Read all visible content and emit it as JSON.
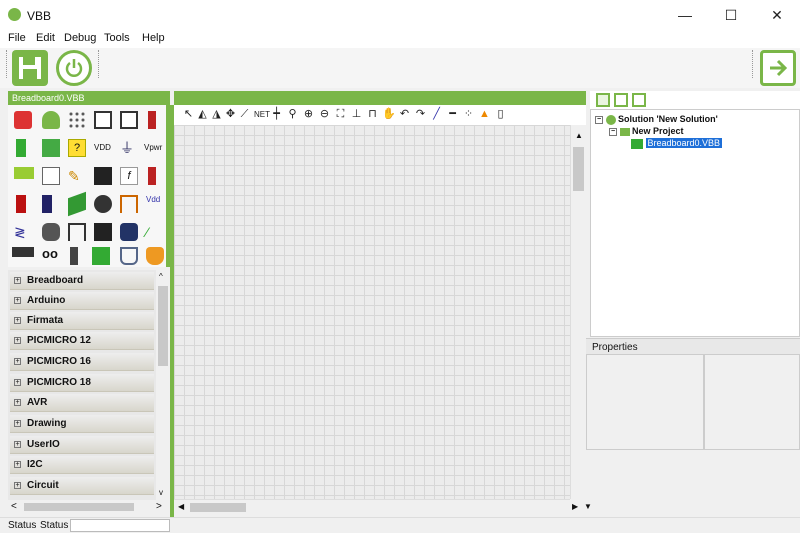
{
  "window": {
    "title": "VBB",
    "minimize": "—",
    "maximize": "☐",
    "close": "✕"
  },
  "menu": [
    "File",
    "Edit",
    "Debug",
    "Tools",
    "Help"
  ],
  "left_panel": {
    "header": "Breadboard0.VBB",
    "categories": [
      "Breadboard",
      "Arduino",
      "Firmata",
      "PICMICRO 12",
      "PICMICRO 16",
      "PICMICRO 18",
      "AVR",
      "Drawing",
      "UserIO",
      "I2C",
      "Circuit"
    ]
  },
  "right_panel": {
    "tree": {
      "solution": "Solution 'New Solution'",
      "project": "New Project",
      "file": "Breadboard0.VBB"
    },
    "properties_label": "Properties"
  },
  "status": {
    "label": "Status",
    "value": "Status"
  },
  "colors": {
    "accent": "#7ab648",
    "grid": "#ececec",
    "selection": "#1e6fd8"
  }
}
